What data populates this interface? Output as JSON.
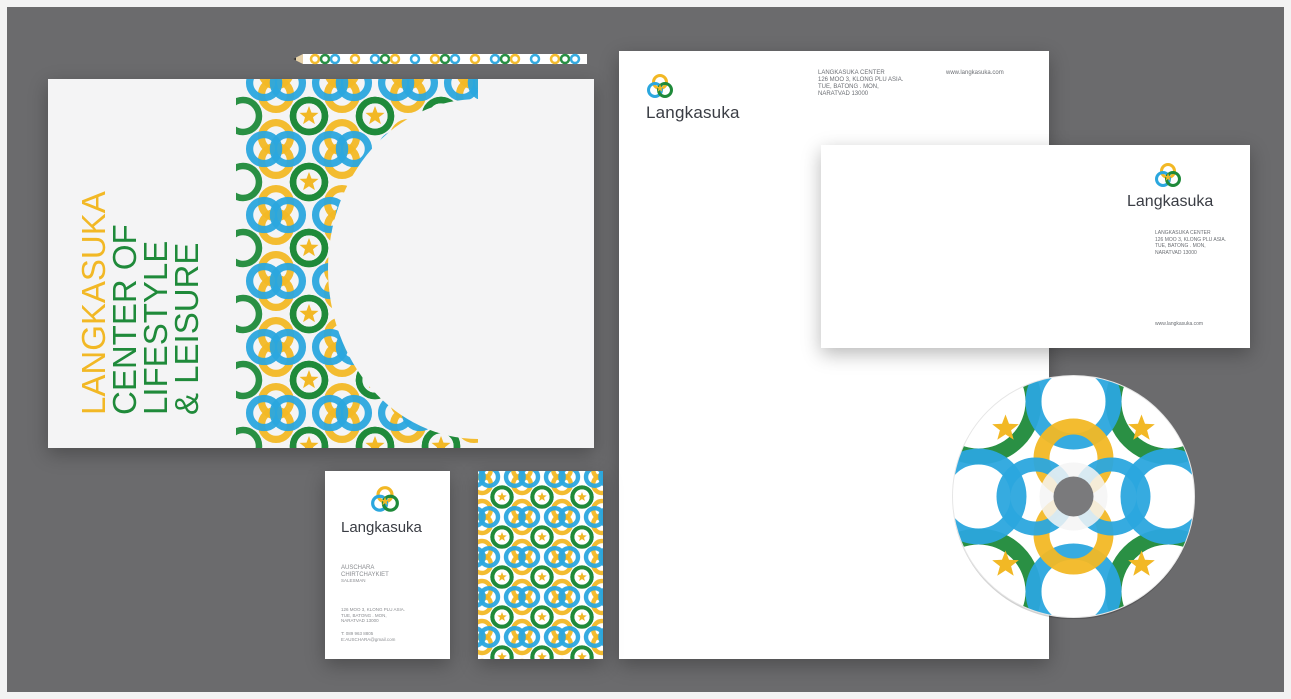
{
  "poster": {
    "line1": "LANGKASUKA",
    "line2": "CENTER OF",
    "line3": "LIFESTYLE",
    "line4": "& LEISURE"
  },
  "letterhead": {
    "logo_text": "Langkasuka",
    "address": [
      "LANGKASUKA CENTER",
      "126 MOO 3, KLONG PLU ASIA.",
      "TUE, BATONG . MON,",
      "NARATVAD 13000"
    ],
    "website": "www.langkasuka.com"
  },
  "envelope": {
    "logo_text": "Langkasuka",
    "address": [
      "LANGKASUKA CENTER",
      "126 MOO 3, KLONG PLU ASIA.",
      "TUE, BATONG . MON,",
      "NARATVAD 13000"
    ],
    "website": "www.langkasuka.com"
  },
  "business_card": {
    "logo_text": "Langkasuka",
    "name_first": "AUSCHARA",
    "name_last": "CHIRTCHAYKIET",
    "role": "SALESMAN",
    "address": [
      "126 MOO 3, KLONG PLU ASIA.",
      "TUE, BATONG . MON,",
      "NARATVAD 13000"
    ],
    "phone": "T: 089 963 8805",
    "email": "E:AUSCHARA@gmail.com"
  },
  "colors": {
    "background": "#6b6b6d",
    "brand_yellow": "#f2b825",
    "brand_green": "#1f8a3a",
    "brand_blue": "#2ba7de",
    "logo_text": "#3a3d44"
  },
  "icons": [
    "langkasuka-logo-icon",
    "star-icon",
    "pencil-icon",
    "cd-hole-icon"
  ]
}
